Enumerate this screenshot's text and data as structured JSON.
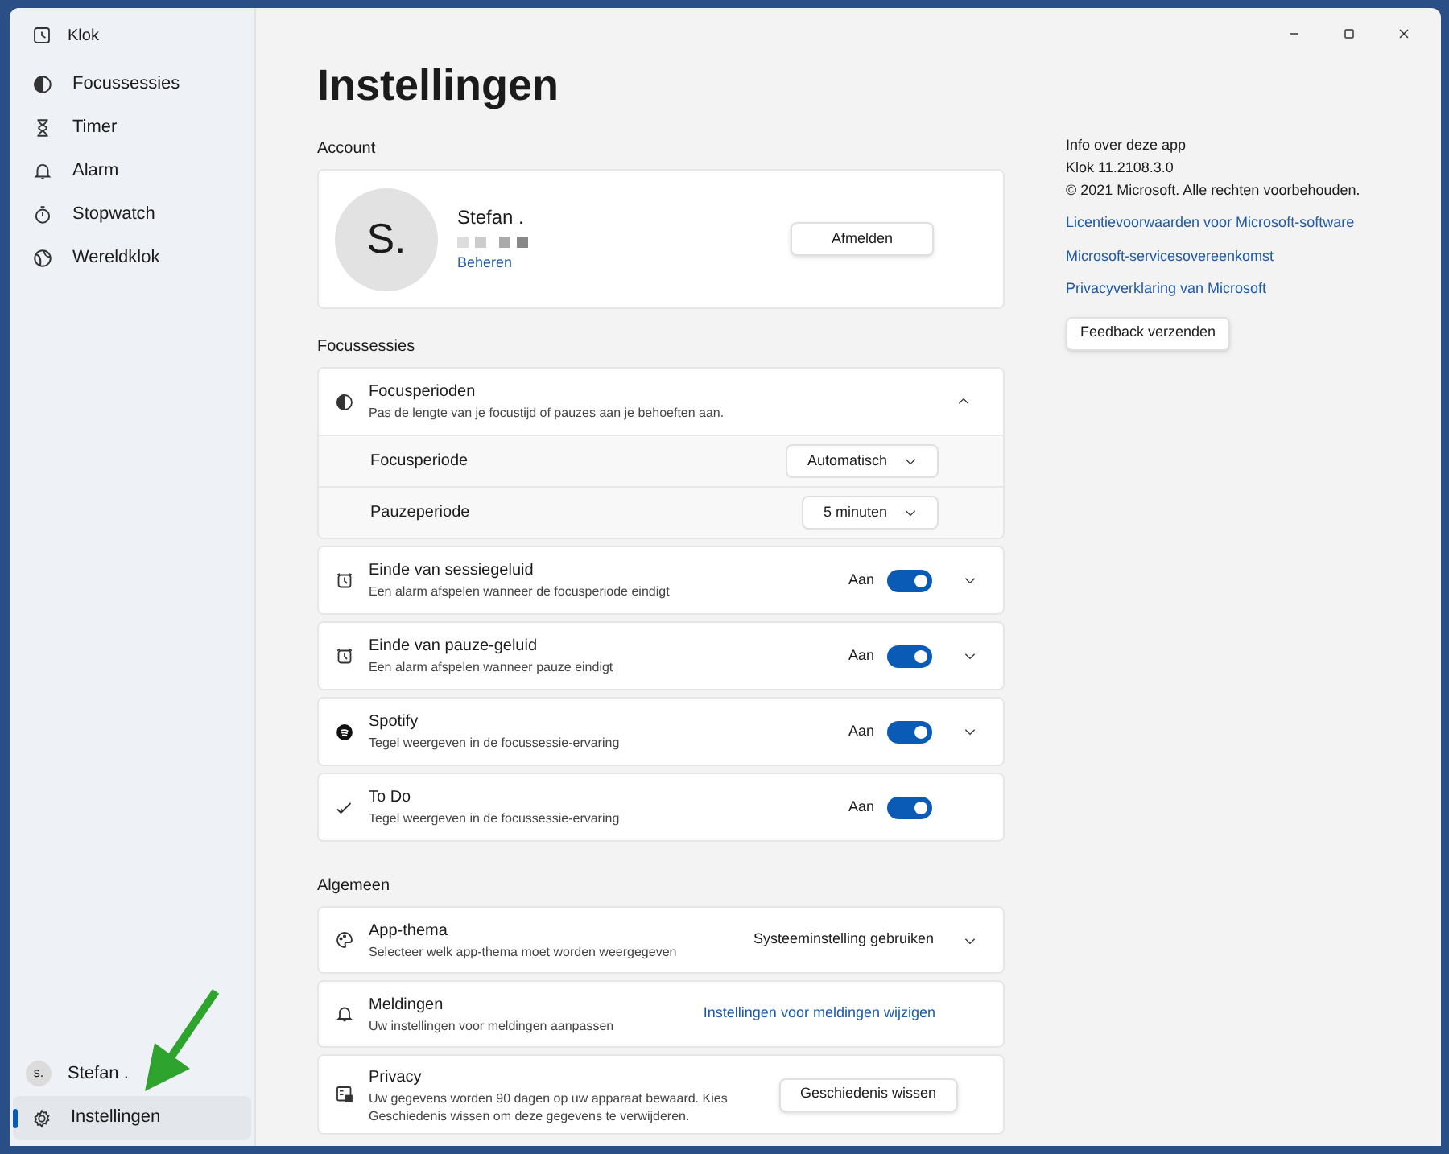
{
  "window": {
    "title": "Klok"
  },
  "nav": {
    "items": [
      {
        "label": "Focussessies",
        "selected": false
      },
      {
        "label": "Timer",
        "selected": false
      },
      {
        "label": "Alarm",
        "selected": false
      },
      {
        "label": "Stopwatch",
        "selected": false
      },
      {
        "label": "Wereldklok",
        "selected": false
      }
    ],
    "user": {
      "initial": "s.",
      "name": "Stefan ."
    },
    "settings": {
      "label": "Instellingen",
      "selected": true
    }
  },
  "page_title": "Instellingen",
  "account": {
    "heading": "Account",
    "avatar_initials": "S.",
    "name": "Stefan .",
    "manage_link": "Beheren",
    "sign_out_button": "Afmelden"
  },
  "focus": {
    "heading": "Focussessies",
    "periods": {
      "title": "Focusperioden",
      "description": "Pas de lengte van je focustijd of pauzes aan je behoeften aan.",
      "expanded": true,
      "rows": [
        {
          "label": "Focusperiode",
          "value": "Automatisch"
        },
        {
          "label": "Pauzeperiode",
          "value": "5 minuten"
        }
      ]
    },
    "toggles": [
      {
        "title": "Einde van sessiegeluid",
        "description": "Een alarm afspelen wanneer de focusperiode eindigt",
        "state_label": "Aan",
        "on": true,
        "expandable": true
      },
      {
        "title": "Einde van pauze-geluid",
        "description": "Een alarm afspelen wanneer pauze eindigt",
        "state_label": "Aan",
        "on": true,
        "expandable": true
      },
      {
        "title": "Spotify",
        "description": "Tegel weergeven in de focussessie-ervaring",
        "state_label": "Aan",
        "on": true,
        "expandable": true
      },
      {
        "title": "To Do",
        "description": "Tegel weergeven in de focussessie-ervaring",
        "state_label": "Aan",
        "on": true,
        "expandable": false
      }
    ]
  },
  "general": {
    "heading": "Algemeen",
    "items": [
      {
        "kind": "dropdown",
        "title": "App-thema",
        "description": "Selecteer welk app-thema moet worden weergegeven",
        "control": "Systeeminstelling gebruiken"
      },
      {
        "kind": "link",
        "title": "Meldingen",
        "description": "Uw instellingen voor meldingen aanpassen",
        "control": "Instellingen voor meldingen wijzigen"
      },
      {
        "kind": "button",
        "title": "Privacy",
        "description": "Uw gegevens worden 90 dagen op uw apparaat bewaard. Kies Geschiedenis wissen om deze gegevens te verwijderen.",
        "control": "Geschiedenis wissen"
      }
    ]
  },
  "about": {
    "lines": [
      "Info over deze app",
      "Klok 11.2108.3.0",
      "© 2021 Microsoft. Alle rechten voorbehouden."
    ],
    "links": [
      "Licentievoorwaarden voor Microsoft-software",
      "Microsoft-servicesovereenkomst",
      "Privacyverklaring van Microsoft"
    ],
    "feedback_button": "Feedback verzenden"
  }
}
